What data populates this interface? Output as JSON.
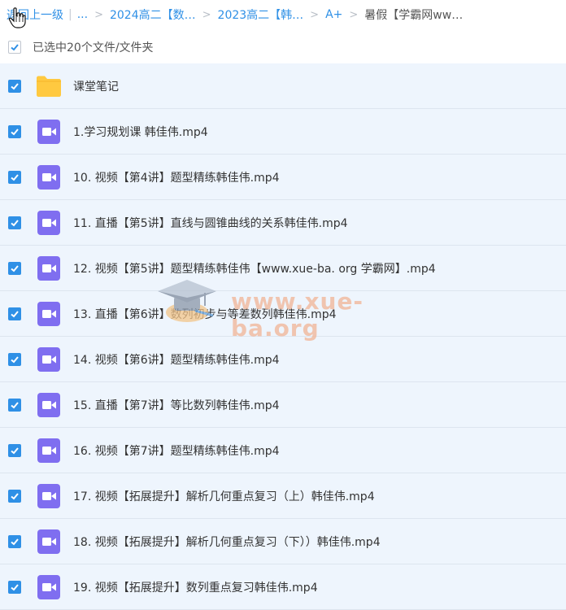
{
  "breadcrumb": {
    "back_label": "返回上一级",
    "pipe": "|",
    "ellipsis": "...",
    "items": [
      "2024高二【数…",
      "2023高二【韩…",
      "A+"
    ],
    "current": "暑假【学霸网ww…",
    "separator": ">"
  },
  "selection": {
    "label": "已选中20个文件/文件夹"
  },
  "files": [
    {
      "name": "课堂笔记",
      "type": "folder"
    },
    {
      "name": "1.学习规划课 韩佳伟.mp4",
      "type": "video"
    },
    {
      "name": "10. 视频【第4讲】题型精练韩佳伟.mp4",
      "type": "video"
    },
    {
      "name": "11. 直播【第5讲】直线与圆锥曲线的关系韩佳伟.mp4",
      "type": "video"
    },
    {
      "name": "12. 视频【第5讲】题型精练韩佳伟【www.xue-ba. org 学霸网】.mp4",
      "type": "video"
    },
    {
      "name": "13. 直播【第6讲】数列初步与等差数列韩佳伟.mp4",
      "type": "video"
    },
    {
      "name": "14. 视频【第6讲】题型精练韩佳伟.mp4",
      "type": "video"
    },
    {
      "name": "15. 直播【第7讲】等比数列韩佳伟.mp4",
      "type": "video"
    },
    {
      "name": "16. 视频【第7讲】题型精练韩佳伟.mp4",
      "type": "video"
    },
    {
      "name": "17. 视频【拓展提升】解析几何重点复习（上）韩佳伟.mp4",
      "type": "video"
    },
    {
      "name": "18. 视频【拓展提升】解析几何重点复习（下））韩佳伟.mp4",
      "type": "video"
    },
    {
      "name": "19. 视频【拓展提升】数列重点复习韩佳伟.mp4",
      "type": "video"
    }
  ],
  "watermark": {
    "text": "www.xue-ba.org"
  },
  "colors": {
    "accent": "#2f90e6",
    "row_bg": "#eef5fd",
    "folder": "#ffc940",
    "video": "#7f6ef0"
  }
}
